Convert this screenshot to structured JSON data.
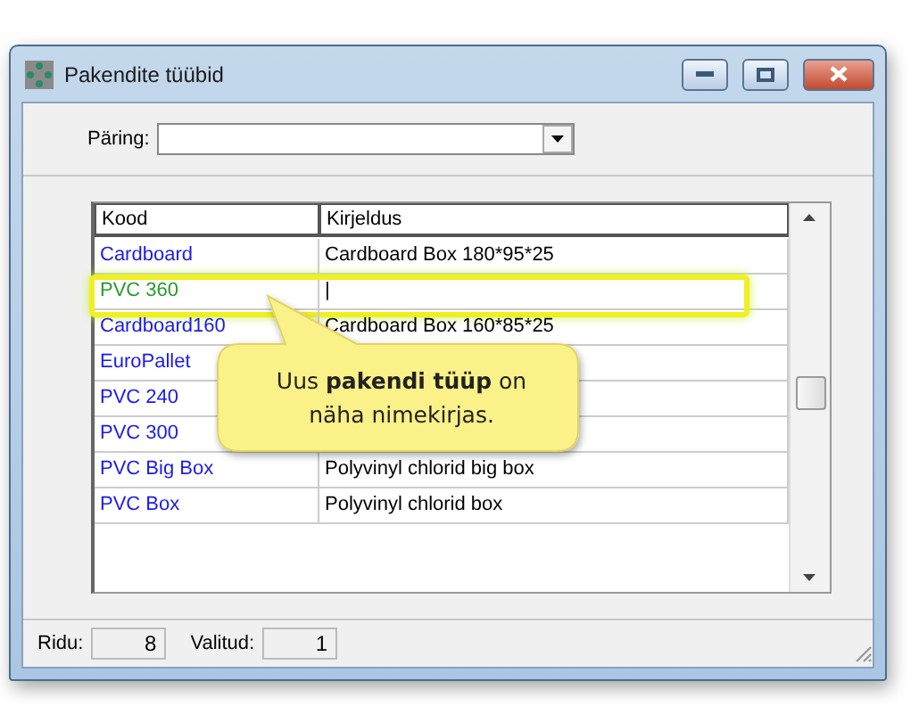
{
  "window": {
    "title": "Pakendite tüübid"
  },
  "query": {
    "label": "Päring:"
  },
  "table": {
    "columns": [
      "Kood",
      "Kirjeldus"
    ],
    "rows": [
      {
        "code": "Cardboard",
        "description": "Cardboard Box 180*95*25",
        "selected": false
      },
      {
        "code": "PVC 360",
        "description": "|",
        "selected": true
      },
      {
        "code": "Cardboard160",
        "description": "Cardboard Box 160*85*25",
        "selected": false
      },
      {
        "code": "EuroPallet",
        "selected": false
      },
      {
        "code": "PVC 240",
        "selected": false
      },
      {
        "code": "PVC 300",
        "selected": false
      },
      {
        "code": "PVC Big Box",
        "description": "Polyvinyl chlorid big box",
        "selected": false
      },
      {
        "code": "PVC Box",
        "description": "Polyvinyl chlorid box",
        "selected": false
      }
    ]
  },
  "callout": {
    "text": "Uus **pakendi tüüp** on näha nimekirjas."
  },
  "status_bar": [
    {
      "label": "Ridu:",
      "value": "8"
    },
    {
      "label": "Valitud:",
      "value": "1"
    }
  ]
}
